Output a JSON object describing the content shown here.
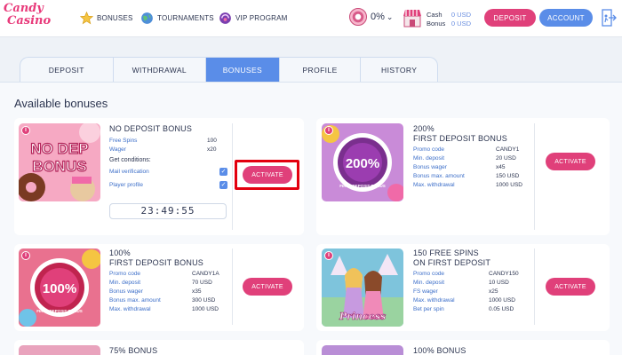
{
  "header": {
    "logo": {
      "line1": "Candy",
      "line2": "Casino"
    },
    "nav": [
      {
        "label": "BONUSES",
        "icon": "star-icon"
      },
      {
        "label": "TOURNAMENTS",
        "icon": "globe-icon"
      },
      {
        "label": "VIP PROGRAM",
        "icon": "vip-icon"
      }
    ],
    "vip_level": "0%",
    "balances": {
      "cash_label": "Cash",
      "cash_value": "0 USD",
      "bonus_label": "Bonus",
      "bonus_value": "0 USD"
    },
    "deposit_button": "DEPOSIT",
    "account_button": "ACCOUNT"
  },
  "tabs": [
    {
      "label": "DEPOSIT",
      "active": false
    },
    {
      "label": "WITHDRAWAL",
      "active": false
    },
    {
      "label": "BONUSES",
      "active": true
    },
    {
      "label": "PROFILE",
      "active": false
    },
    {
      "label": "HISTORY",
      "active": false
    }
  ],
  "section_title": "Available bonuses",
  "bonuses": {
    "no_deposit": {
      "title": "NO DEPOSIT BONUS",
      "thumb_text": [
        "NO DEP",
        "BONUS"
      ],
      "rows": [
        {
          "k": "Free Spins",
          "v": "100"
        },
        {
          "k": "Wager",
          "v": "x20"
        }
      ],
      "conditions_title": "Get conditions:",
      "conditions": [
        {
          "k": "Mail verification",
          "checked": true
        },
        {
          "k": "Player profile",
          "checked": true
        }
      ],
      "timer": "23:49:55",
      "button": "ACTIVATE"
    },
    "first_200": {
      "title1": "200%",
      "title2": "FIRST DEPOSIT BONUS",
      "badge": "200%",
      "badge_sub": "FIRST DEPOSIT BONUS",
      "rows": [
        {
          "k": "Promo code",
          "v": "CANDY1"
        },
        {
          "k": "Min. deposit",
          "v": "20 USD"
        },
        {
          "k": "Bonus wager",
          "v": "x45"
        },
        {
          "k": "Bonus max. amount",
          "v": "150 USD"
        },
        {
          "k": "Max. withdrawal",
          "v": "1000 USD"
        }
      ],
      "button": "ACTIVATE"
    },
    "first_100": {
      "title1": "100%",
      "title2": "FIRST DEPOSIT BONUS",
      "badge": "100%",
      "badge_sub": "FIRST DEPOSIT BONUS",
      "rows": [
        {
          "k": "Promo code",
          "v": "CANDY1A"
        },
        {
          "k": "Min. deposit",
          "v": "70 USD"
        },
        {
          "k": "Bonus wager",
          "v": "x35"
        },
        {
          "k": "Bonus max. amount",
          "v": "300 USD"
        },
        {
          "k": "Max. withdrawal",
          "v": "1000 USD"
        }
      ],
      "button": "ACTIVATE"
    },
    "free_spins": {
      "title1": "150 FREE SPINS",
      "title2": "ON FIRST DEPOSIT",
      "thumb_text": "Princess",
      "rows": [
        {
          "k": "Promo code",
          "v": "CANDY150"
        },
        {
          "k": "Min. deposit",
          "v": "10 USD"
        },
        {
          "k": "FS wager",
          "v": "x25"
        },
        {
          "k": "Max. withdrawal",
          "v": "1000 USD"
        },
        {
          "k": "Bet per spin",
          "v": "0.05 USD"
        }
      ],
      "button": "ACTIVATE"
    },
    "bonus_75": {
      "title": "75% BONUS"
    },
    "bonus_100": {
      "title": "100% BONUS"
    }
  },
  "colors": {
    "accent_pink": "#e0407a",
    "accent_blue": "#5a8de8",
    "highlight_red": "#e3000f"
  }
}
